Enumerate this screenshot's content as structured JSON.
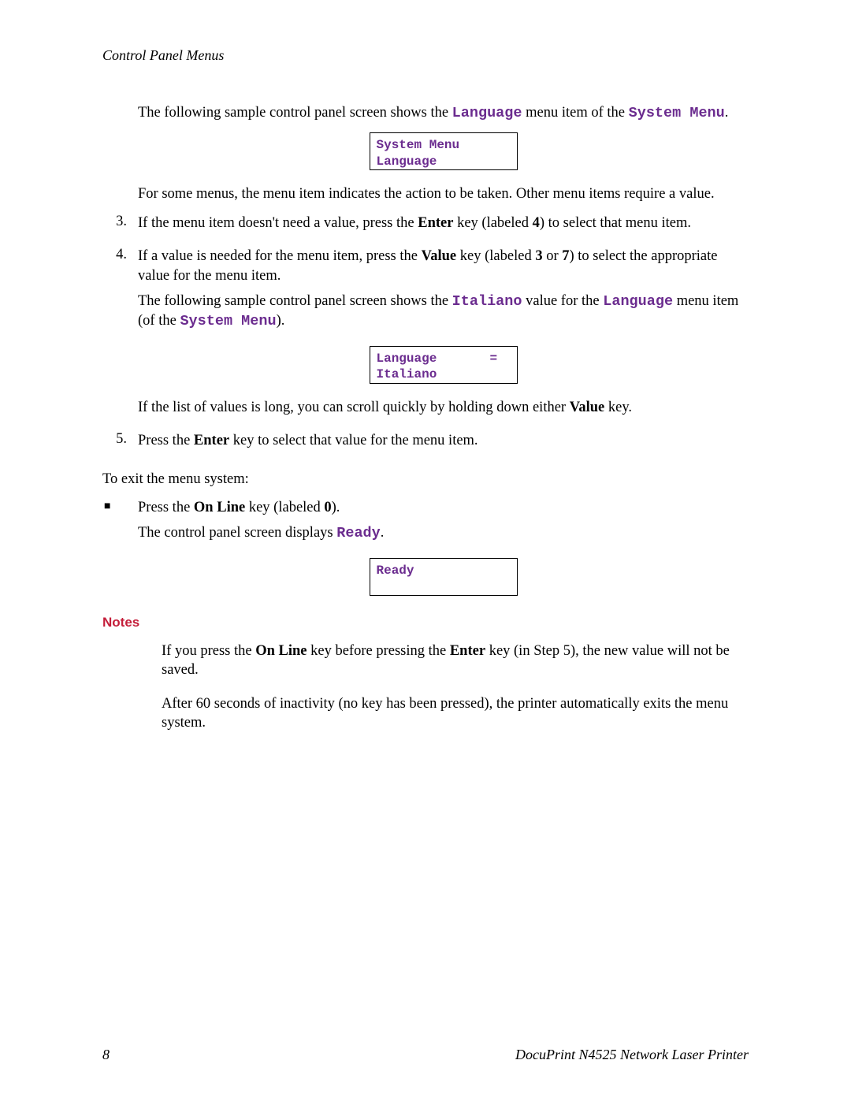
{
  "header": "Control Panel Menus",
  "intro": {
    "line1_a": "The following sample control panel screen shows the ",
    "term1": "Language",
    "line1_b": " menu item of the ",
    "term2": "System Menu",
    "line1_c": "."
  },
  "box1_line1": "System Menu",
  "box1_line2": "Language",
  "para2": "For some menus, the menu item indicates the action to be taken. Other menu items require a value.",
  "item3": {
    "num": "3.",
    "a": "If the menu item doesn't need a value, press the ",
    "b": "Enter",
    "c": " key (labeled ",
    "d": "4",
    "e": ") to select that menu item."
  },
  "item4": {
    "num": "4.",
    "a": "If a value is needed for the menu item, press the ",
    "b": "Value",
    "c": " key (labeled ",
    "d": "3",
    "e": " or ",
    "f": "7",
    "g": ") to select the appropriate value for the menu item.",
    "p2a": "The following sample control panel screen shows the ",
    "p2term1": "Italiano",
    "p2b": " value for the ",
    "p2term2": "Language",
    "p2c": " menu item (of the ",
    "p2term3": "System Menu",
    "p2d": ")."
  },
  "box2_line1": "Language       =",
  "box2_line2": "Italiano",
  "item4b": {
    "a": "If the list of values is long, you can scroll quickly by holding down either ",
    "b": "Value",
    "c": " key."
  },
  "item5": {
    "num": "5.",
    "a": "Press the ",
    "b": "Enter",
    "c": " key to select that value for the menu item."
  },
  "exit_intro": "To exit the menu system:",
  "bullet": {
    "a": "Press the ",
    "b": "On Line",
    "c": " key (labeled ",
    "d": "0",
    "e": ").",
    "p2a": "The control panel screen displays ",
    "p2term": "Ready",
    "p2b": "."
  },
  "box3_line1": "Ready",
  "notes_heading": "Notes",
  "note1": {
    "a": "If you press the ",
    "b": "On Line",
    "c": " key before pressing the ",
    "d": "Enter",
    "e": " key (in Step 5), the new value will not be saved."
  },
  "note2": "After 60 seconds of inactivity (no key has been pressed), the printer automatically exits the menu system.",
  "footer_page": "8",
  "footer_title": "DocuPrint N4525 Network Laser Printer"
}
